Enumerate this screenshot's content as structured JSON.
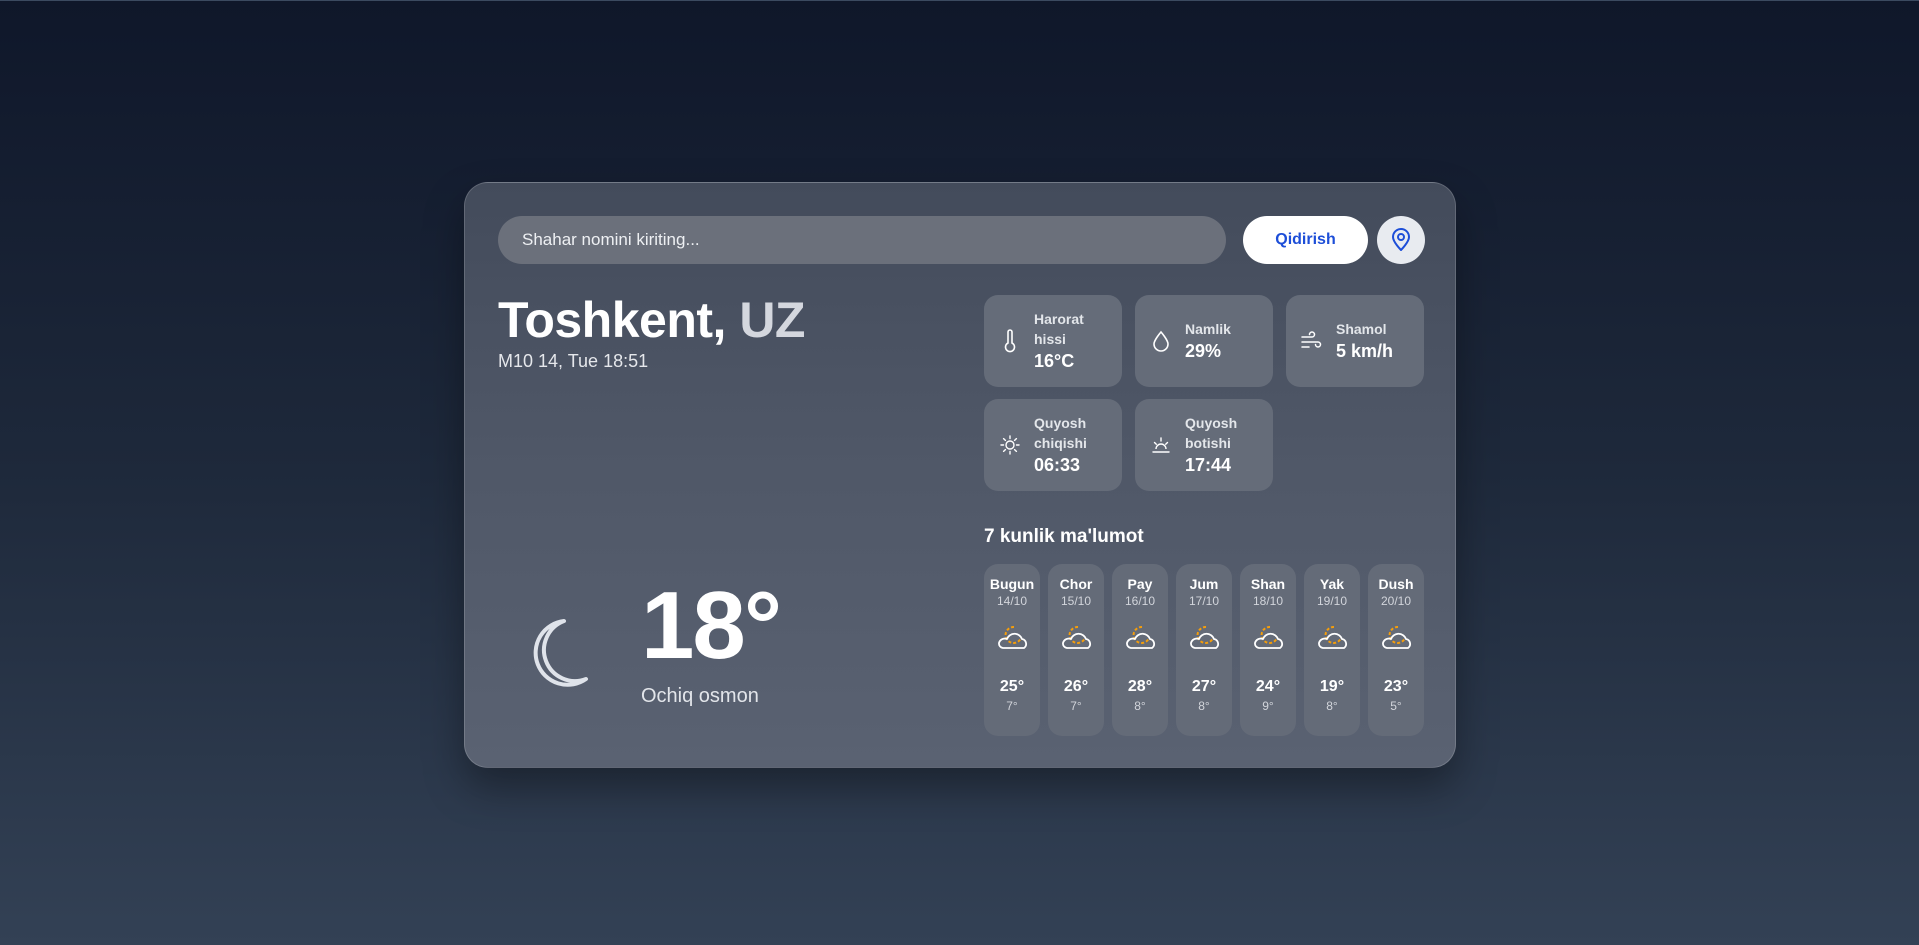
{
  "search": {
    "placeholder": "Shahar nomini kiriting...",
    "button_label": "Qidirish"
  },
  "location": {
    "city": "Toshkent,",
    "country": "UZ",
    "datetime": "M10 14, Tue 18:51"
  },
  "current": {
    "temperature": "18°",
    "description": "Ochiq osmon",
    "icon": "moon-icon"
  },
  "stats": [
    {
      "label": "Harorat hissi",
      "value": "16°C",
      "icon": "thermometer-icon"
    },
    {
      "label": "Namlik",
      "value": "29%",
      "icon": "droplet-icon"
    },
    {
      "label": "Shamol",
      "value": "5 km/h",
      "icon": "wind-icon"
    },
    {
      "label": "Quyosh chiqishi",
      "value": "06:33",
      "icon": "sunrise-icon"
    },
    {
      "label": "Quyosh botishi",
      "value": "17:44",
      "icon": "sunset-icon"
    }
  ],
  "forecast": {
    "title": "7 kunlik ma'lumot",
    "days": [
      {
        "name": "Bugun",
        "date": "14/10",
        "max": "25°",
        "min": "7°",
        "icon": "partly-cloudy-night-icon"
      },
      {
        "name": "Chor",
        "date": "15/10",
        "max": "26°",
        "min": "7°",
        "icon": "partly-cloudy-night-icon"
      },
      {
        "name": "Pay",
        "date": "16/10",
        "max": "28°",
        "min": "8°",
        "icon": "partly-cloudy-night-icon"
      },
      {
        "name": "Jum",
        "date": "17/10",
        "max": "27°",
        "min": "8°",
        "icon": "partly-cloudy-night-icon"
      },
      {
        "name": "Shan",
        "date": "18/10",
        "max": "24°",
        "min": "9°",
        "icon": "partly-cloudy-night-icon"
      },
      {
        "name": "Yak",
        "date": "19/10",
        "max": "19°",
        "min": "8°",
        "icon": "partly-cloudy-night-icon"
      },
      {
        "name": "Dush",
        "date": "20/10",
        "max": "23°",
        "min": "5°",
        "icon": "partly-cloudy-night-icon"
      }
    ]
  },
  "colors": {
    "accent": "#1d4ed8",
    "icon_sun": "#f59e0b"
  }
}
